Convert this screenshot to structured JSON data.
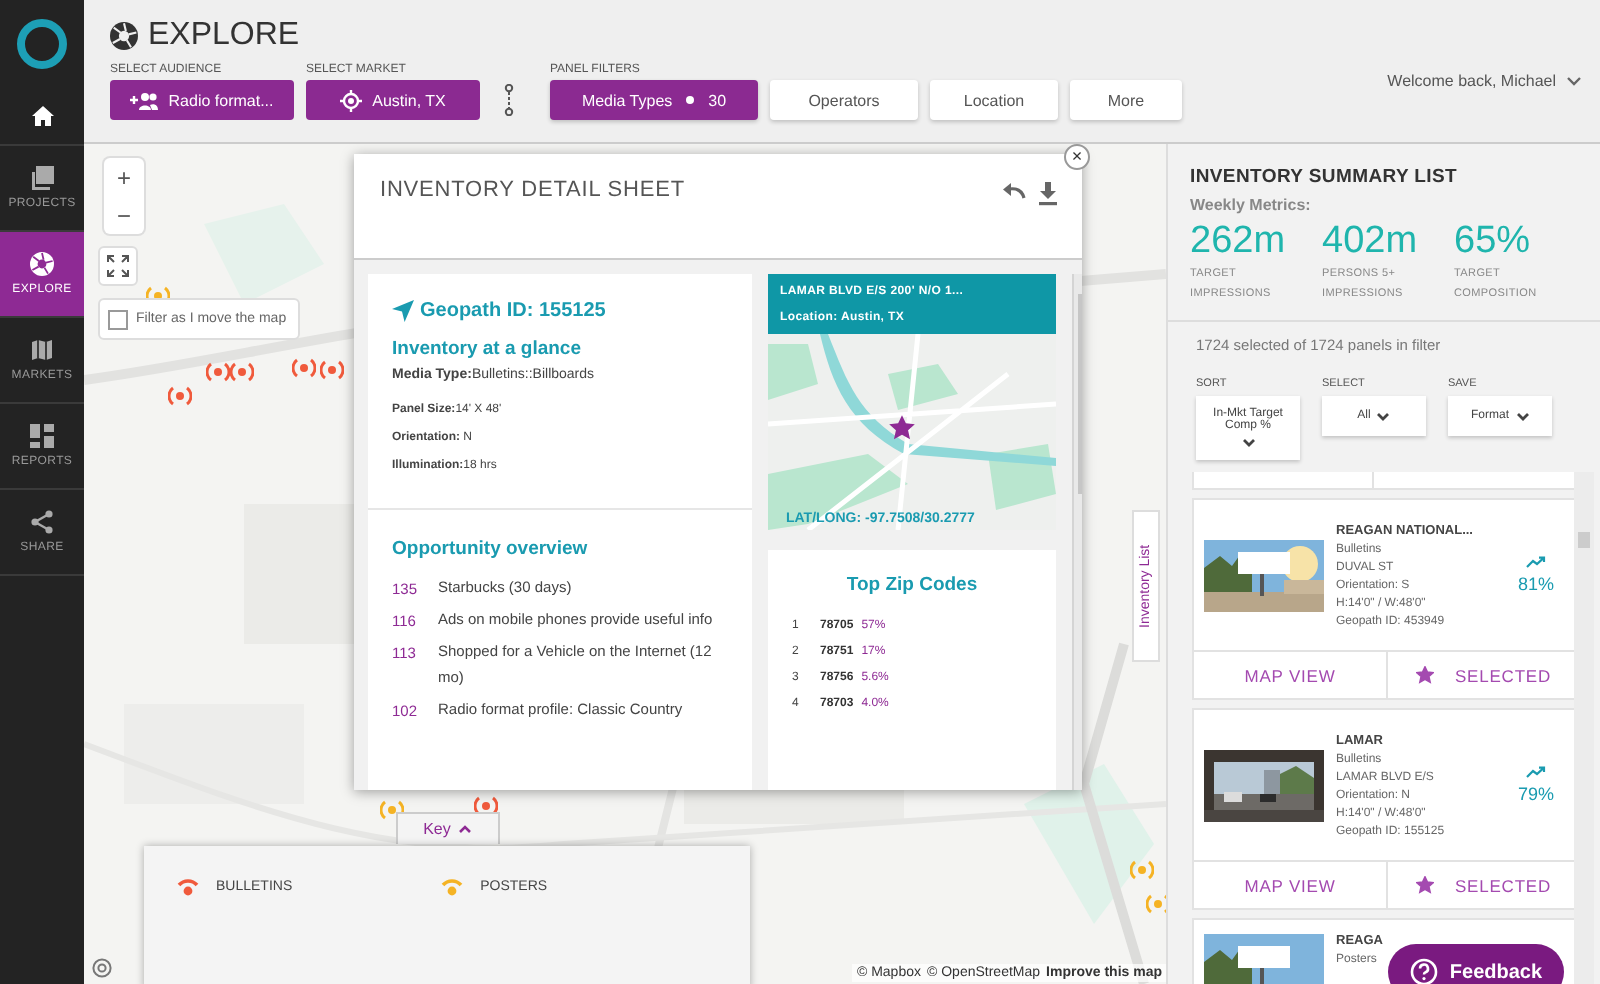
{
  "nav": {
    "items": [
      {
        "kind": "home",
        "selected": false
      },
      {
        "kind": "projects",
        "label": "PROJECTS",
        "selected": false
      },
      {
        "kind": "explore",
        "label": "EXPLORE",
        "selected": true
      },
      {
        "kind": "markets",
        "label": "MARKETS",
        "selected": false
      },
      {
        "kind": "reports",
        "label": "REPORTS",
        "selected": false
      },
      {
        "kind": "share",
        "label": "SHARE",
        "selected": false
      }
    ]
  },
  "header": {
    "title": "EXPLORE",
    "welcome": "Welcome back, Michael",
    "audience": {
      "label": "SELECT AUDIENCE",
      "value": "Radio format..."
    },
    "market": {
      "label": "SELECT MARKET",
      "value": "Austin, TX"
    },
    "filters_label": "PANEL FILTERS",
    "filters": [
      {
        "label": "Media Types",
        "count": "30",
        "selected": true
      },
      {
        "label": "Operators",
        "selected": false
      },
      {
        "label": "Location",
        "selected": false
      },
      {
        "label": "More",
        "selected": false
      }
    ]
  },
  "map": {
    "zoom_in": "+",
    "zoom_out": "−",
    "filter_checkbox": {
      "label": "Filter as I move the map",
      "checked": false
    },
    "markers": [
      {
        "kind": "poster"
      },
      {
        "kind": "bulletin"
      },
      {
        "kind": "bulletin"
      },
      {
        "kind": "bulletin"
      },
      {
        "kind": "bulletin"
      },
      {
        "kind": "bulletin"
      },
      {
        "kind": "poster"
      },
      {
        "kind": "bulletin"
      },
      {
        "kind": "poster"
      },
      {
        "kind": "poster"
      }
    ],
    "key": {
      "label": "Key",
      "expanded": true,
      "items": [
        {
          "label": "BULLETINS",
          "color": "#f05a3c"
        },
        {
          "label": "POSTERS",
          "color": "#f5b324"
        }
      ]
    },
    "attribution": [
      "© Mapbox",
      "© OpenStreetMap",
      "Improve this map"
    ],
    "inventory_tab": "Inventory List"
  },
  "detail": {
    "title": "INVENTORY DETAIL SHEET",
    "close": "×",
    "geopath": "Geopath ID: 155125",
    "glance_title": "Inventory at a glance",
    "facts": [
      "**Media Type:**Bulletins::Billboards",
      "**Panel Size:**14' X 48'",
      "**Orientation:** N",
      "**Illumination:**18 hrs"
    ],
    "opportunity_title": "Opportunity overview",
    "opportunities": [
      {
        "score": "135",
        "text": "Starbucks (30 days)"
      },
      {
        "score": "116",
        "text": "Ads on mobile phones provide useful info"
      },
      {
        "score": "113",
        "text": "Shopped for a Vehicle on the Internet (12 mo)"
      },
      {
        "score": "102",
        "text": "Radio format profile: Classic Country"
      }
    ],
    "address": "LAMAR BLVD E/S 200' N/O 1...",
    "location": "Location: Austin, TX",
    "latlong": "LAT/LONG: -97.7508/30.2777",
    "zip_title": "Top Zip Codes",
    "zips": [
      {
        "rank": "1",
        "zip": "78705",
        "share": "57%"
      },
      {
        "rank": "2",
        "zip": "78751",
        "share": "17%"
      },
      {
        "rank": "3",
        "zip": "78756",
        "share": "5.6%"
      },
      {
        "rank": "4",
        "zip": "78703",
        "share": "4.0%"
      }
    ]
  },
  "summary": {
    "title": "INVENTORY SUMMARY LIST",
    "metrics_label": "Weekly Metrics:",
    "metrics": [
      {
        "value": "262m",
        "label": "TARGET IMPRESSIONS"
      },
      {
        "value": "402m",
        "label": "PERSONS 5+ IMPRESSIONS"
      },
      {
        "value": "65%",
        "label": "TARGET COMPOSITION"
      }
    ],
    "count": "1724 selected of 1724 panels in filter",
    "controls": [
      {
        "label": "SORT",
        "value": "In-Mkt Target Comp %"
      },
      {
        "label": "SELECT",
        "value": "All"
      },
      {
        "label": "SAVE",
        "value": "Format"
      }
    ],
    "cards": [
      {
        "title": "REAGAN NATIONAL...",
        "format": "Bulletins",
        "street": "DUVAL ST",
        "orientation": "Orientation: S",
        "size": "H:14'0\" / W:48'0\"",
        "geopath": "Geopath ID: 453949",
        "score": "81%",
        "map_button": "MAP VIEW",
        "select_button": "SELECTED",
        "selected": true
      },
      {
        "title": "LAMAR",
        "format": "Bulletins",
        "street": "LAMAR BLVD E/S",
        "orientation": "Orientation: N",
        "size": "H:14'0\" / W:48'0\"",
        "geopath": "Geopath ID: 155125",
        "score": "79%",
        "map_button": "MAP VIEW",
        "select_button": "SELECTED",
        "selected": true
      }
    ],
    "partial_card": {
      "title": "REAGA",
      "format": "Posters"
    },
    "feedback": "Feedback"
  }
}
